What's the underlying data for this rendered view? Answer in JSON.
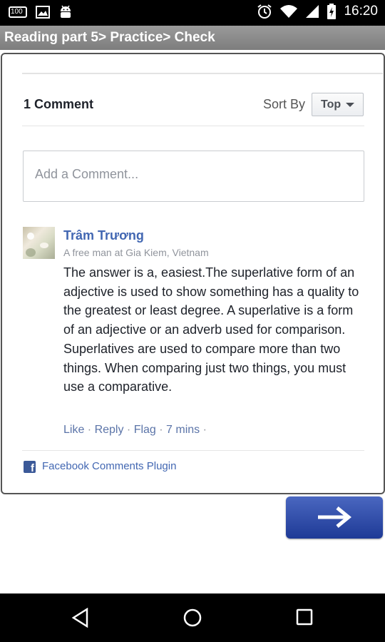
{
  "status_bar": {
    "time": "16:20",
    "battery_badge": "100",
    "icons": [
      "battery-badge-icon",
      "image-icon",
      "android-icon",
      "alarm-icon",
      "wifi-icon",
      "signal-icon",
      "battery-charging-icon"
    ]
  },
  "title_bar": {
    "title": "Reading part 5> Practice> Check"
  },
  "comments": {
    "count_label": "1 Comment",
    "sort_label": "Sort By",
    "sort_value": "Top",
    "input_placeholder": "Add a Comment...",
    "items": [
      {
        "author": "Trâm Trương",
        "subtitle": "A free man at Gia Kiem, Vietnam",
        "text": "The answer is a, easiest.The superlative form of an adjective is used to show something has a quality to the greatest or least degree. A superlative is a form of an adjective or an adverb used for comparison. Superlatives are used to compare more than two things. When comparing just two things, you must use a comparative.",
        "actions": {
          "like": "Like",
          "reply": "Reply",
          "flag": "Flag",
          "time": "7 mins"
        }
      }
    ],
    "plugin_label": "Facebook Comments Plugin"
  },
  "colors": {
    "link_blue": "#4267b2",
    "button_blue": "#2c49a8",
    "title_bar": "#8a8a8a"
  },
  "nav_bar": {
    "icons": [
      "back-icon",
      "home-icon",
      "recents-icon"
    ]
  }
}
